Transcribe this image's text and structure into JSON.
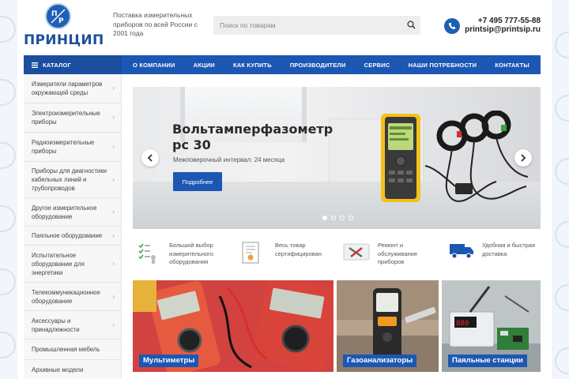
{
  "header": {
    "logo_text": "ПРИНЦИП",
    "tagline": "Поставка измерительных приборов по всей России с 2001 года",
    "search_placeholder": "Поиск по товарам",
    "phone": "+7 495 777-55-88",
    "email": "printsip@printsip.ru"
  },
  "nav": {
    "catalog_label": "КАТАЛОГ",
    "items": [
      "О КОМПАНИИ",
      "АКЦИИ",
      "КАК КУПИТЬ",
      "ПРОИЗВОДИТЕЛИ",
      "СЕРВИС",
      "НАШИ ПОТРЕБНОСТИ",
      "КОНТАКТЫ"
    ]
  },
  "sidebar": {
    "items": [
      "Измерители параметров окружающей среды",
      "Электроизмерительные приборы",
      "Радиоизмерительные приборы",
      "Приборы для диагностики кабельных линий и трубопроводов",
      "Другое измерительное оборудование",
      "Паяльное оборудование",
      "Испытательное оборудование для энергетики",
      "Телекоммуникационное оборудование",
      "Аксессуары и принадлежности",
      "Промышленная мебель",
      "Архивные модели"
    ]
  },
  "slider": {
    "title": "Вольтамперфазометр рс 30",
    "subtitle": "Межповерочный интервал: 24 месяца",
    "button_label": "Подробнее",
    "slide_count": 4,
    "active_slide": 1
  },
  "features": [
    {
      "icon": "checklist-icon",
      "text": "Большой выбор измерительного оборудования"
    },
    {
      "icon": "certificate-icon",
      "text": "Весь товар сертифицирован"
    },
    {
      "icon": "tools-icon",
      "text": "Ремонт и обслуживание приборов"
    },
    {
      "icon": "delivery-truck-icon",
      "text": "Удобная и быстрая доставка"
    }
  ],
  "categories": [
    "Мультиметры",
    "Газоанализаторы",
    "Паяльные станции"
  ],
  "colors": {
    "brand_blue": "#1c57b3",
    "nav_catalog": "#1b4e9f",
    "sidebar_bg": "#f7f7f7"
  }
}
